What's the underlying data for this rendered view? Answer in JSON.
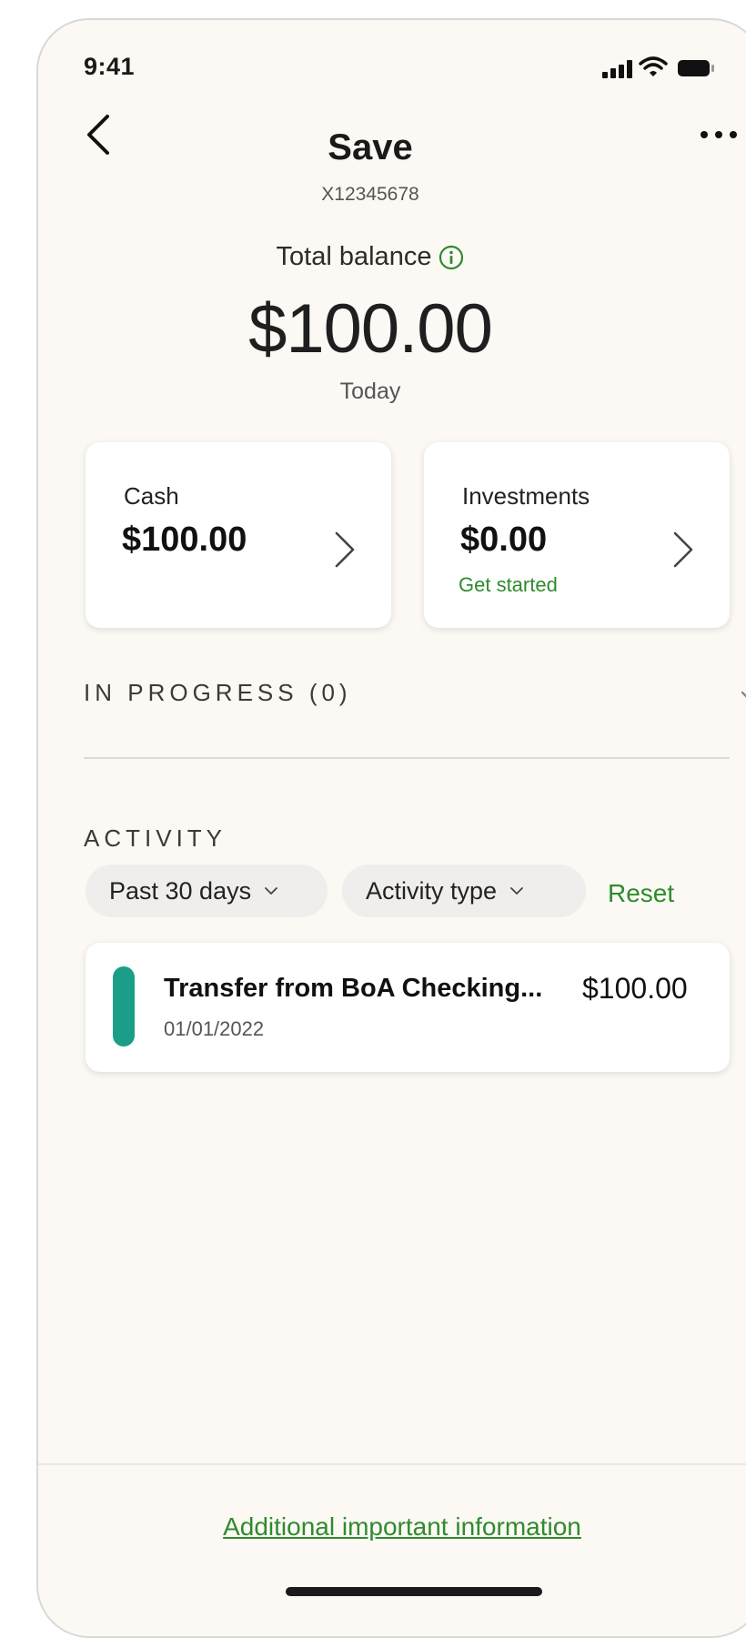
{
  "status_bar": {
    "time": "9:41"
  },
  "header": {
    "title": "Save",
    "account_number": "X12345678"
  },
  "balance": {
    "label": "Total balance",
    "amount": "$100.00",
    "as_of": "Today"
  },
  "cards": {
    "cash": {
      "label": "Cash",
      "amount": "$100.00"
    },
    "investments": {
      "label": "Investments",
      "amount": "$0.00",
      "cta": "Get started"
    }
  },
  "in_progress": {
    "label": "IN PROGRESS (0)"
  },
  "activity": {
    "title": "ACTIVITY",
    "filters": {
      "period": "Past 30 days",
      "type": "Activity type",
      "reset": "Reset"
    },
    "transactions": [
      {
        "title": "Transfer from BoA Checking...",
        "date": "01/01/2022",
        "amount": "$100.00"
      }
    ]
  },
  "footer": {
    "link": "Additional important information"
  },
  "colors": {
    "accent_green": "#2e8b2e",
    "transaction_marker": "#1a9e87",
    "background": "#fcf9f4"
  },
  "icons": [
    "signal-icon",
    "wifi-icon",
    "battery-icon",
    "back-chevron-icon",
    "more-options-icon",
    "info-icon",
    "chevron-right-icon",
    "chevron-down-icon"
  ]
}
